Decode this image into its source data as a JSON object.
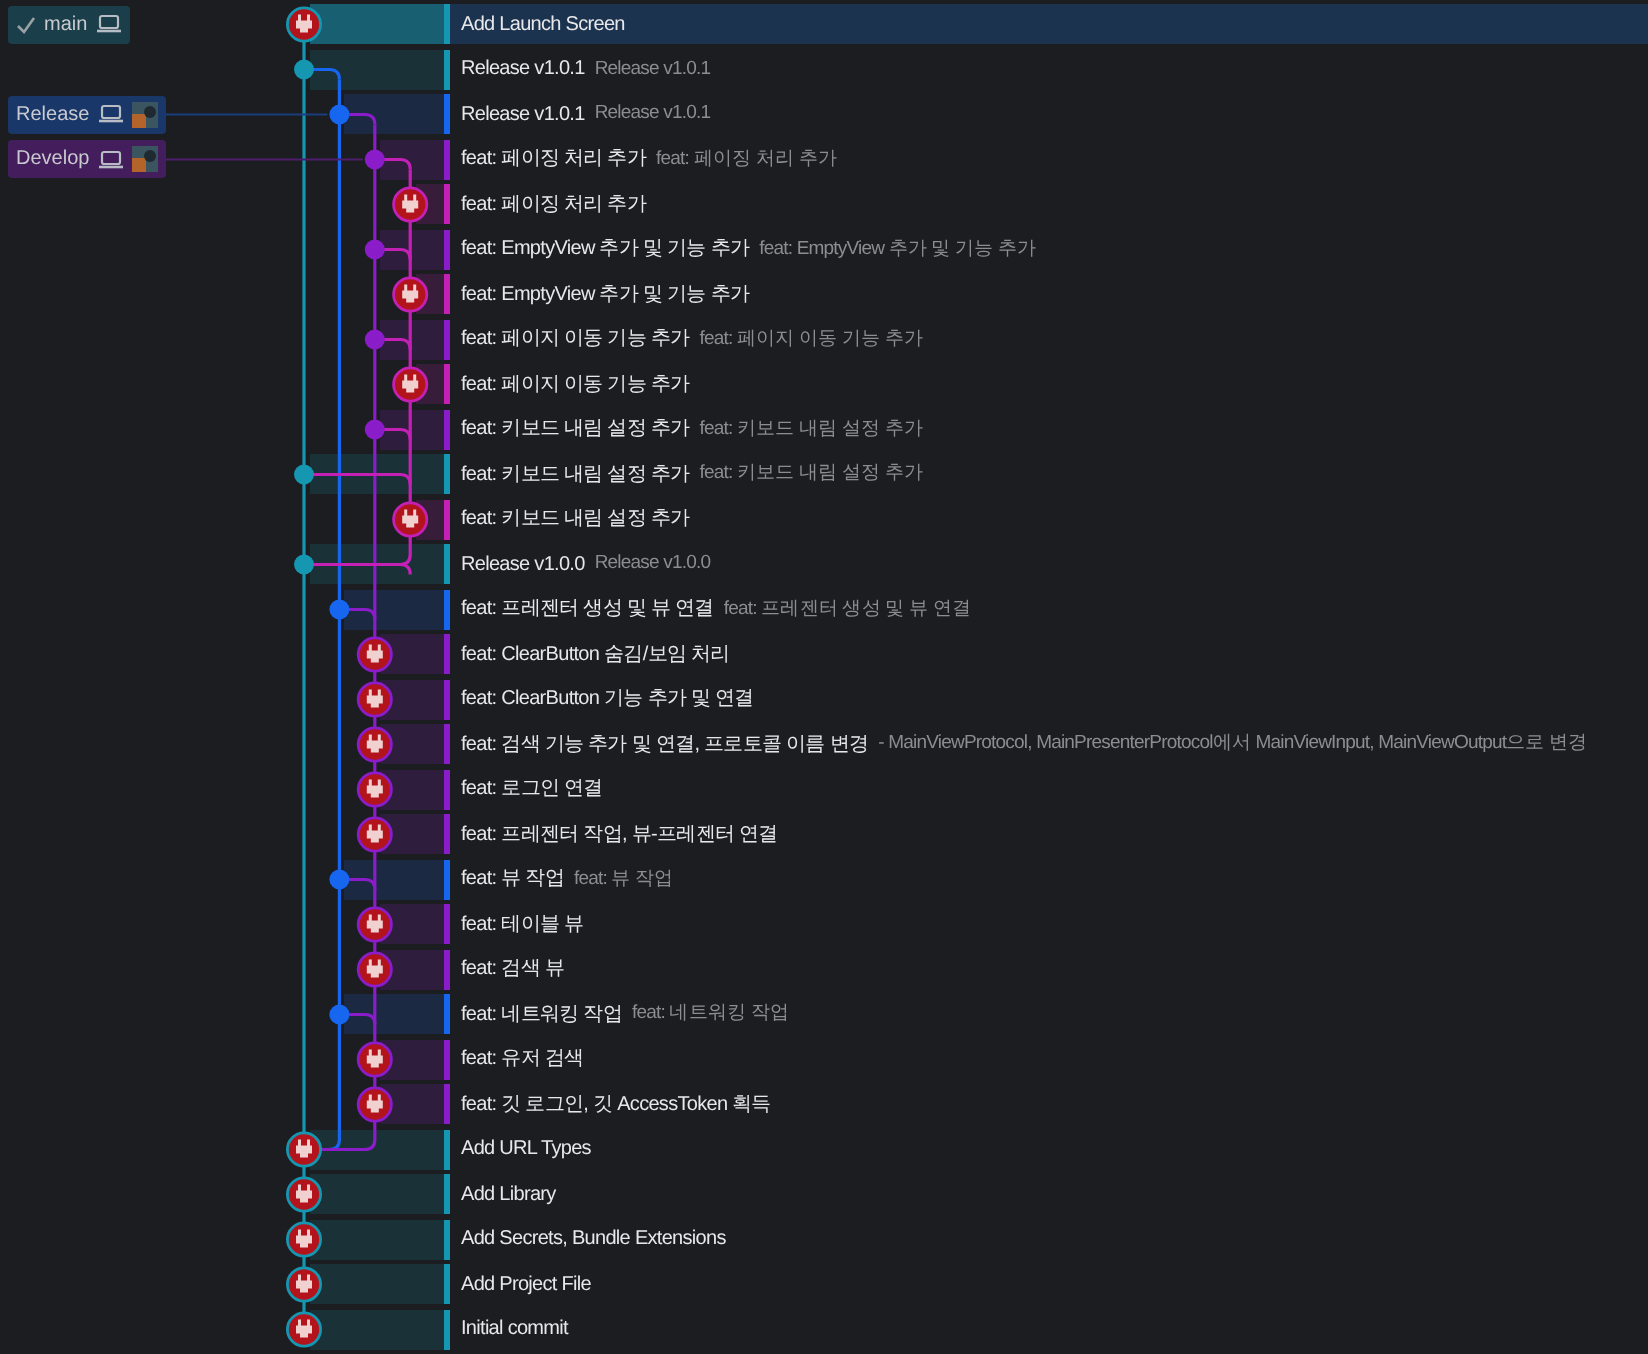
{
  "commits": [
    {
      "color": "#1597b2",
      "kind": "avatar",
      "message": "Add Launch Screen",
      "selected": true,
      "refs": [
        {
          "label": "main",
          "checked": true,
          "avatar": false
        }
      ]
    },
    {
      "color": "#1597b2",
      "kind": "dot",
      "message": "Release v1.0.1",
      "description": "Release v1.0.1",
      "selected": false
    },
    {
      "color": "#1766f0",
      "kind": "dot",
      "message": "Release v1.0.1",
      "description": "Release v1.0.1",
      "selected": false,
      "refs": [
        {
          "label": "Release",
          "checked": false,
          "avatar": true
        }
      ]
    },
    {
      "color": "#8a1cc9",
      "kind": "dot",
      "message": "feat: 페이징 처리 추가",
      "description": "feat: 페이징 처리 추가",
      "selected": false,
      "refs": [
        {
          "label": "Develop",
          "checked": false,
          "avatar": true
        }
      ]
    },
    {
      "color": "#c420b6",
      "kind": "avatar",
      "message": "feat: 페이징 처리 추가",
      "selected": false
    },
    {
      "color": "#8a1cc9",
      "kind": "dot",
      "message": "feat: EmptyView 추가 및 기능 추가",
      "description": "feat: EmptyView 추가 및 기능 추가",
      "selected": false
    },
    {
      "color": "#c420b6",
      "kind": "avatar",
      "message": "feat: EmptyView 추가 및 기능 추가",
      "selected": false
    },
    {
      "color": "#8a1cc9",
      "kind": "dot",
      "message": "feat: 페이지 이동 기능 추가",
      "description": "feat: 페이지 이동 기능 추가",
      "selected": false
    },
    {
      "color": "#c420b6",
      "kind": "avatar",
      "message": "feat: 페이지 이동 기능 추가",
      "selected": false
    },
    {
      "color": "#8a1cc9",
      "kind": "dot",
      "message": "feat: 키보드 내림 설정 추가",
      "description": "feat: 키보드 내림 설정 추가",
      "selected": false
    },
    {
      "color": "#1597b2",
      "kind": "dot",
      "message": "feat: 키보드 내림 설정 추가",
      "description": "feat: 키보드 내림 설정 추가",
      "selected": false
    },
    {
      "color": "#c420b6",
      "kind": "avatar",
      "message": "feat: 키보드 내림 설정 추가",
      "selected": false
    },
    {
      "color": "#1597b2",
      "kind": "dot",
      "message": "Release v1.0.0",
      "description": "Release v1.0.0",
      "selected": false
    },
    {
      "color": "#1766f0",
      "kind": "dot",
      "message": "feat: 프레젠터 생성 및 뷰 연결",
      "description": "feat: 프레젠터 생성 및 뷰 연결",
      "selected": false
    },
    {
      "color": "#8a1cc9",
      "kind": "avatar",
      "message": "feat: ClearButton 숨김/보임 처리",
      "selected": false
    },
    {
      "color": "#8a1cc9",
      "kind": "avatar",
      "message": "feat: ClearButton 기능 추가 및 연결",
      "selected": false
    },
    {
      "color": "#8a1cc9",
      "kind": "avatar",
      "message": "feat: 검색 기능 추가 및 연결, 프로토콜 이름 변경",
      "description": "- MainViewProtocol, MainPresenterProtocol에서 MainViewInput, MainViewOutput으로 변경",
      "selected": false
    },
    {
      "color": "#8a1cc9",
      "kind": "avatar",
      "message": "feat: 로그인 연결",
      "selected": false
    },
    {
      "color": "#8a1cc9",
      "kind": "avatar",
      "message": "feat: 프레젠터 작업, 뷰-프레젠터 연결",
      "selected": false
    },
    {
      "color": "#1766f0",
      "kind": "dot",
      "message": "feat: 뷰 작업",
      "description": "feat: 뷰 작업",
      "selected": false
    },
    {
      "color": "#8a1cc9",
      "kind": "avatar",
      "message": "feat: 테이블 뷰",
      "selected": false
    },
    {
      "color": "#8a1cc9",
      "kind": "avatar",
      "message": "feat: 검색 뷰",
      "selected": false
    },
    {
      "color": "#1766f0",
      "kind": "dot",
      "message": "feat: 네트워킹 작업",
      "description": "feat: 네트워킹 작업",
      "selected": false
    },
    {
      "color": "#8a1cc9",
      "kind": "avatar",
      "message": "feat: 유저 검색",
      "selected": false
    },
    {
      "color": "#8a1cc9",
      "kind": "avatar",
      "message": "feat: 깃 로그인, 깃 AccessToken 획득",
      "selected": false
    },
    {
      "color": "#1597b2",
      "kind": "avatar",
      "message": "Add URL Types",
      "selected": false
    },
    {
      "color": "#1597b2",
      "kind": "avatar",
      "message": "Add Library",
      "selected": false
    },
    {
      "color": "#1597b2",
      "kind": "avatar",
      "message": "Add Secrets, Bundle Extensions",
      "selected": false
    },
    {
      "color": "#1597b2",
      "kind": "avatar",
      "message": "Add Project File",
      "selected": false
    },
    {
      "color": "#1597b2",
      "kind": "avatar",
      "message": "Initial commit",
      "selected": false
    }
  ]
}
